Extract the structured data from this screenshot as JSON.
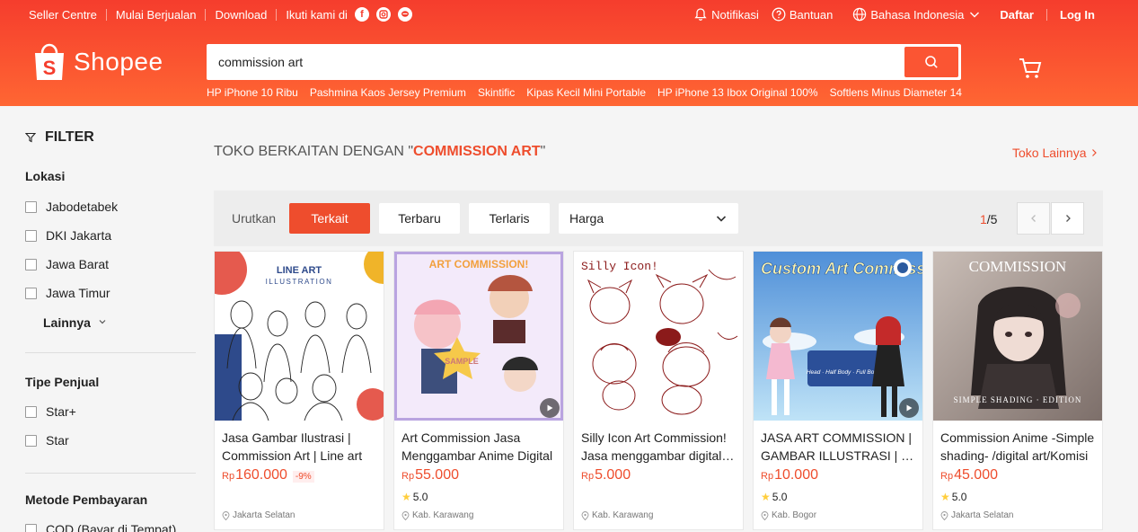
{
  "topbar": {
    "left": [
      "Seller Centre",
      "Mulai Berjualan",
      "Download",
      "Ikuti kami di"
    ],
    "social_icons": [
      "facebook-icon",
      "instagram-icon",
      "line-icon"
    ],
    "notifications": "Notifikasi",
    "help": "Bantuan",
    "language": "Bahasa Indonesia",
    "signup": "Daftar",
    "login": "Log In"
  },
  "header": {
    "logo_text": "Shopee",
    "search_value": "commission art",
    "suggestions": [
      "HP iPhone 10 Ribu",
      "Pashmina Kaos Jersey Premium",
      "Skintific",
      "Kipas Kecil Mini Portable",
      "HP iPhone 13 Ibox Original 100%",
      "Softlens Minus Diameter 14"
    ]
  },
  "sidebar": {
    "title": "FILTER",
    "location": {
      "title": "Lokasi",
      "items": [
        "Jabodetabek",
        "DKI Jakarta",
        "Jawa Barat",
        "Jawa Timur"
      ],
      "more": "Lainnya"
    },
    "seller_type": {
      "title": "Tipe Penjual",
      "items": [
        "Star+",
        "Star"
      ]
    },
    "payment": {
      "title": "Metode Pembayaran",
      "items": [
        "COD (Bayar di Tempat)"
      ]
    }
  },
  "main": {
    "shops_prefix": "TOKO BERKAITAN DENGAN \"",
    "shops_keyword": "COMMISSION ART",
    "shops_suffix": "\"",
    "more_shops": "Toko Lainnya",
    "sort": {
      "label": "Urutkan",
      "options": [
        "Terkait",
        "Terbaru",
        "Terlaris"
      ],
      "price_select": "Harga",
      "page_current": "1",
      "page_total": "/5"
    },
    "products": [
      {
        "name": "Jasa Gambar Ilustrasi | Commission Art | Line art",
        "currency": "Rp",
        "price": "160.000",
        "discount": "-9%",
        "rating": "",
        "location": "Jakarta Selatan",
        "video": false
      },
      {
        "name": "Art Commission Jasa Menggambar Anime Digital",
        "currency": "Rp",
        "price": "55.000",
        "discount": "",
        "rating": "5.0",
        "location": "Kab. Karawang",
        "video": true
      },
      {
        "name": "Silly Icon Art Commission! Jasa menggambar digital…",
        "currency": "Rp",
        "price": "5.000",
        "discount": "",
        "rating": "",
        "location": "Kab. Karawang",
        "video": false
      },
      {
        "name": "JASA ART COMMISSION | GAMBAR ILLUSTRASI | …",
        "currency": "Rp",
        "price": "10.000",
        "discount": "",
        "rating": "5.0",
        "location": "Kab. Bogor",
        "video": true
      },
      {
        "name": "Commission Anime -Simple shading- /digital art/Komisi",
        "currency": "Rp",
        "price": "45.000",
        "discount": "",
        "rating": "5.0",
        "location": "Jakarta Selatan",
        "video": false
      }
    ],
    "images": [
      {
        "title": "LINE ART",
        "subtitle": "ILLUSTRATION"
      },
      {
        "title": "ART COMMISSION!",
        "subtitle": "SAMPLE"
      },
      {
        "title": "Silly Icon!",
        "subtitle": ""
      },
      {
        "title": "Custom Art Commission",
        "subtitle": "Head · Half Body · Full Body"
      },
      {
        "title": "COMMISSION",
        "subtitle": "SIMPLE SHADING · EDITION"
      }
    ]
  },
  "colors": {
    "brand": "#ee4d2d",
    "header_top": "#f53d2d",
    "header_bottom": "#ff6633"
  }
}
